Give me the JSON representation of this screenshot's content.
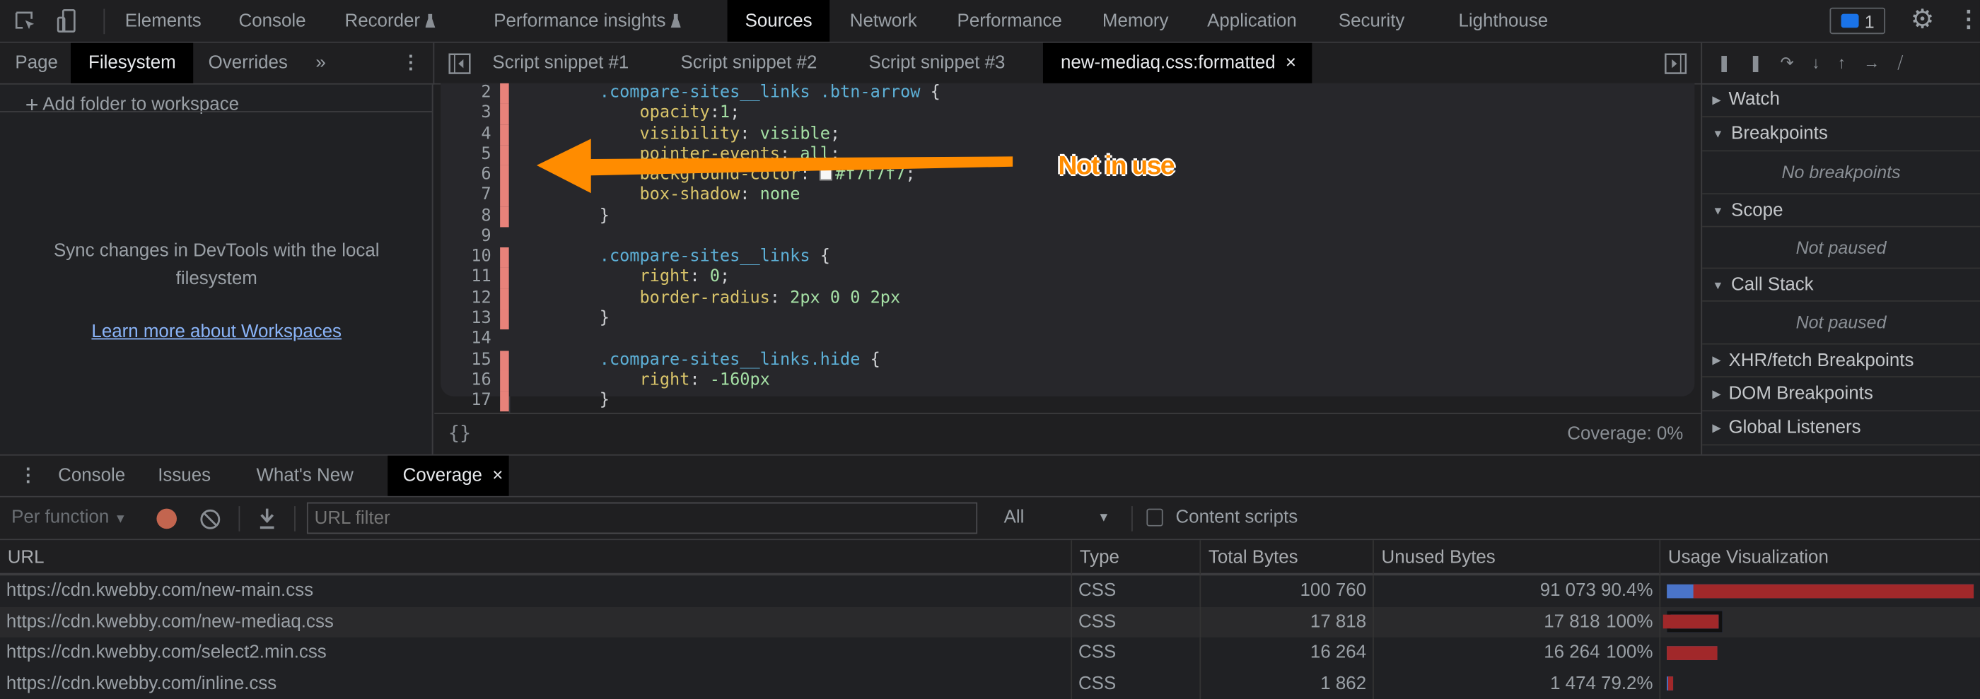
{
  "main_tabs": [
    "Elements",
    "Console",
    "Recorder",
    "Performance insights",
    "Sources",
    "Network",
    "Performance",
    "Memory",
    "Application",
    "Security",
    "Lighthouse"
  ],
  "issues_badge": "1",
  "navigator_tabs": [
    "Page",
    "Filesystem",
    "Overrides",
    "»"
  ],
  "editor_tabs": [
    "Script snippet #1",
    "Script snippet #2",
    "Script snippet #3",
    "new-mediaq.css:formatted"
  ],
  "close_glyph": "×",
  "navigator": {
    "add_folder": "Add folder to workspace",
    "sync_text": "Sync changes in DevTools with the local filesystem",
    "learn_more": "Learn more about Workspaces"
  },
  "code_lines": [
    {
      "num": "2",
      "covered": true,
      "parts": [
        [
          "sel",
          "    .compare-sites__links .btn-arrow"
        ],
        [
          "pun",
          " {"
        ]
      ]
    },
    {
      "num": "3",
      "covered": true,
      "parts": [
        [
          "prop",
          "        opacity"
        ],
        [
          "pun",
          ":"
        ],
        [
          "val",
          "1"
        ],
        [
          "pun",
          ";"
        ]
      ]
    },
    {
      "num": "4",
      "covered": true,
      "parts": [
        [
          "prop",
          "        visibility"
        ],
        [
          "pun",
          ": "
        ],
        [
          "val",
          "visible"
        ],
        [
          "pun",
          ";"
        ]
      ]
    },
    {
      "num": "5",
      "covered": true,
      "parts": [
        [
          "prop",
          "        pointer-events"
        ],
        [
          "pun",
          ": "
        ],
        [
          "val",
          "all"
        ],
        [
          "pun",
          ";"
        ]
      ]
    },
    {
      "num": "6",
      "covered": true,
      "parts": [
        [
          "prop",
          "        background-color"
        ],
        [
          "pun",
          ": "
        ],
        [
          "swatch",
          ""
        ],
        [
          "val",
          "#f7f7f7"
        ],
        [
          "pun",
          ";"
        ]
      ]
    },
    {
      "num": "7",
      "covered": true,
      "parts": [
        [
          "prop",
          "        box-shadow"
        ],
        [
          "pun",
          ": "
        ],
        [
          "val",
          "none"
        ]
      ]
    },
    {
      "num": "8",
      "covered": true,
      "parts": [
        [
          "pun",
          "    }"
        ]
      ]
    },
    {
      "num": "9",
      "covered": false,
      "parts": []
    },
    {
      "num": "10",
      "covered": true,
      "parts": [
        [
          "sel",
          "    .compare-sites__links"
        ],
        [
          "pun",
          " {"
        ]
      ]
    },
    {
      "num": "11",
      "covered": true,
      "parts": [
        [
          "prop",
          "        right"
        ],
        [
          "pun",
          ": "
        ],
        [
          "val",
          "0"
        ],
        [
          "pun",
          ";"
        ]
      ]
    },
    {
      "num": "12",
      "covered": true,
      "parts": [
        [
          "prop",
          "        border-radius"
        ],
        [
          "pun",
          ": "
        ],
        [
          "val",
          "2px 0 0 2px"
        ]
      ]
    },
    {
      "num": "13",
      "covered": true,
      "parts": [
        [
          "pun",
          "    }"
        ]
      ]
    },
    {
      "num": "14",
      "covered": false,
      "parts": []
    },
    {
      "num": "15",
      "covered": true,
      "parts": [
        [
          "sel",
          "    .compare-sites__links.hide"
        ],
        [
          "pun",
          " {"
        ]
      ]
    },
    {
      "num": "16",
      "covered": true,
      "parts": [
        [
          "prop",
          "        right"
        ],
        [
          "pun",
          ": "
        ],
        [
          "val",
          "-160px"
        ]
      ]
    },
    {
      "num": "17",
      "covered": true,
      "parts": [
        [
          "pun",
          "    }"
        ]
      ]
    }
  ],
  "annotation": {
    "text": "Not in use",
    "color": "#ff8c00"
  },
  "editor_footer": {
    "pretty_print": "{}",
    "coverage": "Coverage: 0%"
  },
  "debugger": {
    "sections": [
      "Watch",
      "Breakpoints",
      "Scope",
      "Call Stack",
      "XHR/fetch Breakpoints",
      "DOM Breakpoints",
      "Global Listeners"
    ],
    "no_breakpoints": "No breakpoints",
    "not_paused": "Not paused"
  },
  "drawer_tabs": [
    "Console",
    "Issues",
    "What's New",
    "Coverage"
  ],
  "coverage_toolbar": {
    "mode": "Per function",
    "url_filter_placeholder": "URL filter",
    "type_filter": "All",
    "content_scripts": "Content scripts",
    "content_scripts_checked": false
  },
  "coverage_table": {
    "headers": [
      "URL",
      "Type",
      "Total Bytes",
      "Unused Bytes",
      "Usage Visualization"
    ],
    "rows": [
      {
        "url": "https://cdn.kwebby.com/new-main.css",
        "type": "CSS",
        "total": "100 760",
        "unused": "91 073",
        "pct": "90.4%",
        "total_n": 100760,
        "unused_n": 91073
      },
      {
        "url": "https://cdn.kwebby.com/new-mediaq.css",
        "type": "CSS",
        "total": "17 818",
        "unused": "17 818",
        "pct": "100%",
        "total_n": 17818,
        "unused_n": 17818,
        "selected": true
      },
      {
        "url": "https://cdn.kwebby.com/select2.min.css",
        "type": "CSS",
        "total": "16 264",
        "unused": "16 264",
        "pct": "100%",
        "total_n": 16264,
        "unused_n": 16264
      },
      {
        "url": "https://cdn.kwebby.com/inline.css",
        "type": "CSS",
        "total": "1 862",
        "unused": "1 474",
        "pct": "79.2%",
        "total_n": 1862,
        "unused_n": 1474
      }
    ]
  },
  "colors": {
    "unused": "#a1282a",
    "used": "#4a74c9",
    "accent": "#8ab4f8"
  }
}
